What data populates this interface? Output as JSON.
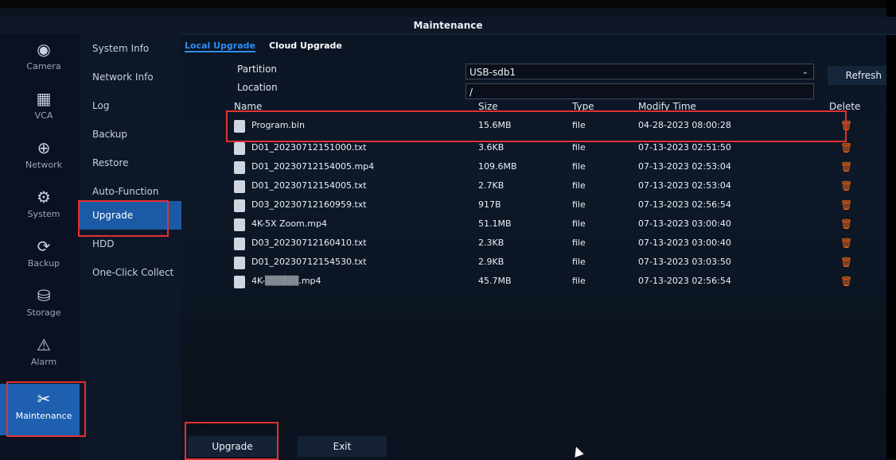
{
  "window": {
    "title": "Maintenance"
  },
  "left_nav": [
    {
      "label": "Camera",
      "icon": "camera-icon"
    },
    {
      "label": "VCA",
      "icon": "vca-icon"
    },
    {
      "label": "Network",
      "icon": "globe-icon"
    },
    {
      "label": "System",
      "icon": "gear-icon"
    },
    {
      "label": "Backup",
      "icon": "backup-icon"
    },
    {
      "label": "Storage",
      "icon": "storage-icon"
    },
    {
      "label": "Alarm",
      "icon": "alarm-icon"
    },
    {
      "label": "Maintenance",
      "icon": "tools-icon"
    }
  ],
  "sub_nav": [
    {
      "label": "System Info"
    },
    {
      "label": "Network Info"
    },
    {
      "label": "Log"
    },
    {
      "label": "Backup"
    },
    {
      "label": "Restore"
    },
    {
      "label": "Auto-Function"
    },
    {
      "label": "Upgrade"
    },
    {
      "label": "HDD"
    },
    {
      "label": "One-Click Collect"
    }
  ],
  "tabs": [
    {
      "label": "Local Upgrade",
      "active": true
    },
    {
      "label": "Cloud Upgrade",
      "active": false
    }
  ],
  "form": {
    "partition_label": "Partition",
    "partition_value": "USB-sdb1",
    "location_label": "Location",
    "location_value": "/",
    "refresh_label": "Refresh"
  },
  "table": {
    "headers": {
      "name": "Name",
      "size": "Size",
      "type": "Type",
      "modify_time": "Modify Time",
      "delete": "Delete"
    },
    "rows": [
      {
        "name": "Program.bin",
        "size": "15.6MB",
        "type": "file",
        "modify_time": "04-28-2023 08:00:28"
      },
      {
        "name": "D01_20230712151000.txt",
        "size": "3.6KB",
        "type": "file",
        "modify_time": "07-13-2023 02:51:50"
      },
      {
        "name": "D01_20230712154005.mp4",
        "size": "109.6MB",
        "type": "file",
        "modify_time": "07-13-2023 02:53:04"
      },
      {
        "name": "D01_20230712154005.txt",
        "size": "2.7KB",
        "type": "file",
        "modify_time": "07-13-2023 02:53:04"
      },
      {
        "name": "D03_20230712160959.txt",
        "size": "917B",
        "type": "file",
        "modify_time": "07-13-2023 02:56:54"
      },
      {
        "name": "4K-5X Zoom.mp4",
        "size": "51.1MB",
        "type": "file",
        "modify_time": "07-13-2023 03:00:40"
      },
      {
        "name": "D03_20230712160410.txt",
        "size": "2.3KB",
        "type": "file",
        "modify_time": "07-13-2023 03:00:40"
      },
      {
        "name": "D01_20230712154530.txt",
        "size": "2.9KB",
        "type": "file",
        "modify_time": "07-13-2023 03:03:50"
      },
      {
        "name": "4K-▒▒▒▒▒.mp4",
        "size": "45.7MB",
        "type": "file",
        "modify_time": "07-13-2023 02:56:54"
      }
    ]
  },
  "buttons": {
    "upgrade": "Upgrade",
    "exit": "Exit"
  },
  "colors": {
    "accent": "#2f8df0",
    "active_bg": "#1c5aa6",
    "highlight": "#e23131",
    "trash": "#ff6a13"
  }
}
